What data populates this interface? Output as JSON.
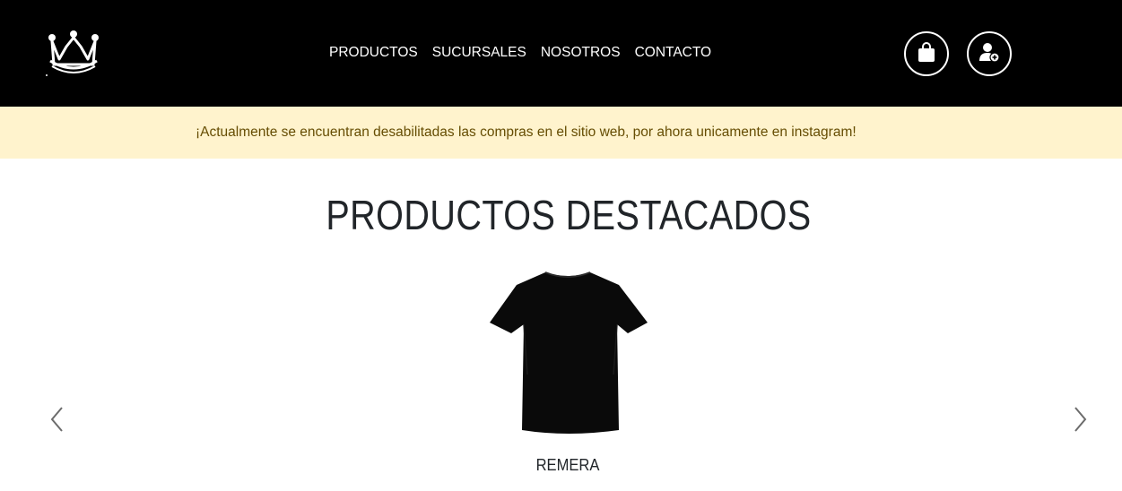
{
  "navbar": {
    "background": "#000000",
    "logo_icon": "crown-icon",
    "links": [
      {
        "label": "PRODUCTOS"
      },
      {
        "label": "SUCURSALES"
      },
      {
        "label": "NOSOTROS"
      },
      {
        "label": "CONTACTO"
      }
    ],
    "cart_icon": "shopping-bag-icon",
    "user_icon": "user-plus-icon"
  },
  "alert": {
    "text": "¡Actualmente se encuentran desabilitadas las compras en el sitio web, por ahora unicamente en instagram!",
    "background": "#fff3cd",
    "color": "#664d03"
  },
  "featured": {
    "title": "PRODUCTOS DESTACADOS",
    "products": [
      {
        "name": "REMERA",
        "image_icon": "tshirt-image"
      }
    ],
    "prev_icon": "chevron-left-icon",
    "next_icon": "chevron-right-icon"
  }
}
